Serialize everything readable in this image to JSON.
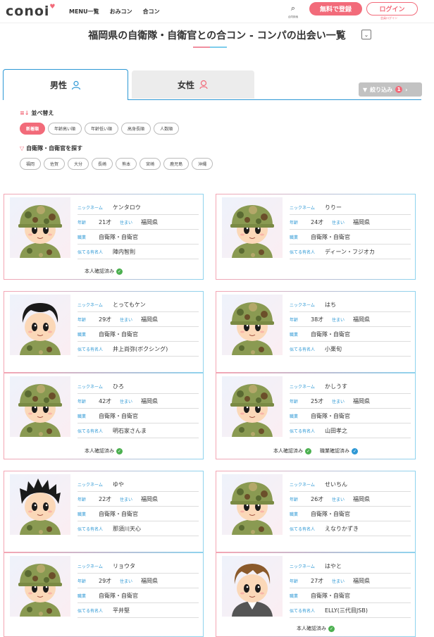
{
  "header": {
    "logo": "conoi",
    "nav": [
      "MENU一覧",
      "おみコン",
      "合コン"
    ],
    "search_label": "合同検索",
    "register": "無料で登録",
    "login": "ログイン",
    "login_sub": "会員ログイン"
  },
  "page": {
    "title": "福岡県の自衛隊・自衛官との合コン - コンパの出会い一覧",
    "expand_icon": "chevron-down-icon"
  },
  "tabs": [
    {
      "label": "男性",
      "icon": "male-user-icon",
      "color": "#2d98d5"
    },
    {
      "label": "女性",
      "icon": "female-user-icon",
      "color": "#f26b7a"
    }
  ],
  "filter": {
    "label": "絞り込み",
    "count": "1"
  },
  "sort": {
    "heading": "並べ替え",
    "options": [
      "新着順",
      "年齢高い順",
      "年齢低い順",
      "高身長順",
      "人数順"
    ],
    "active": 0
  },
  "area": {
    "heading": "自衛隊・自衛官を探す",
    "options": [
      "福岡",
      "佐賀",
      "大分",
      "長崎",
      "熊本",
      "宮崎",
      "鹿児島",
      "沖縄"
    ]
  },
  "labels": {
    "nickname": "ニックネーム",
    "age": "年齢",
    "residence": "住まい",
    "job": "職業",
    "lookalike": "似てる有名人",
    "verified": "本人確認済み",
    "job_verified": "職業確認済み"
  },
  "profiles": [
    {
      "nickname": "ケンタロウ",
      "age": "21才",
      "residence": "福岡県",
      "job": "自衛隊・自衛官",
      "lookalike": "陣内智則",
      "verified": true,
      "avatar": "helmet-soldier"
    },
    {
      "nickname": "りりー",
      "age": "24才",
      "residence": "福岡県",
      "job": "自衛隊・自衛官",
      "lookalike": "ディーン・フジオカ",
      "avatar": "helmet-soldier"
    },
    {
      "nickname": "とってもケン",
      "age": "29才",
      "residence": "福岡県",
      "job": "自衛隊・自衛官",
      "lookalike": "井上尚弥(ボクシング)",
      "avatar": "black-hair"
    },
    {
      "nickname": "はち",
      "age": "38才",
      "residence": "福岡県",
      "job": "自衛隊・自衛官",
      "lookalike": "小栗旬",
      "avatar": "helmet-soldier"
    },
    {
      "nickname": "ひろ",
      "age": "42才",
      "residence": "福岡県",
      "job": "自衛隊・自衛官",
      "lookalike": "明石家さんま",
      "verified": true,
      "avatar": "helmet-soldier"
    },
    {
      "nickname": "かしうす",
      "age": "25才",
      "residence": "福岡県",
      "job": "自衛隊・自衛官",
      "lookalike": "山田孝之",
      "verified": true,
      "job_verified": true,
      "avatar": "helmet-soldier"
    },
    {
      "nickname": "ゆや",
      "age": "22才",
      "residence": "福岡県",
      "job": "自衛隊・自衛官",
      "lookalike": "那須川天心",
      "avatar": "spiky-hair"
    },
    {
      "nickname": "せいちん",
      "age": "26才",
      "residence": "福岡県",
      "job": "自衛隊・自衛官",
      "lookalike": "えなりかずき",
      "avatar": "helmet-soldier"
    },
    {
      "nickname": "リョウタ",
      "age": "29才",
      "residence": "福岡県",
      "job": "自衛隊・自衛官",
      "lookalike": "平井堅",
      "avatar": "helmet-soldier"
    },
    {
      "nickname": "はやと",
      "age": "27才",
      "residence": "福岡県",
      "job": "自衛隊・自衛官",
      "lookalike": "ELLY(三代目JSB)",
      "verified": true,
      "avatar": "brown-hair-suit"
    }
  ]
}
